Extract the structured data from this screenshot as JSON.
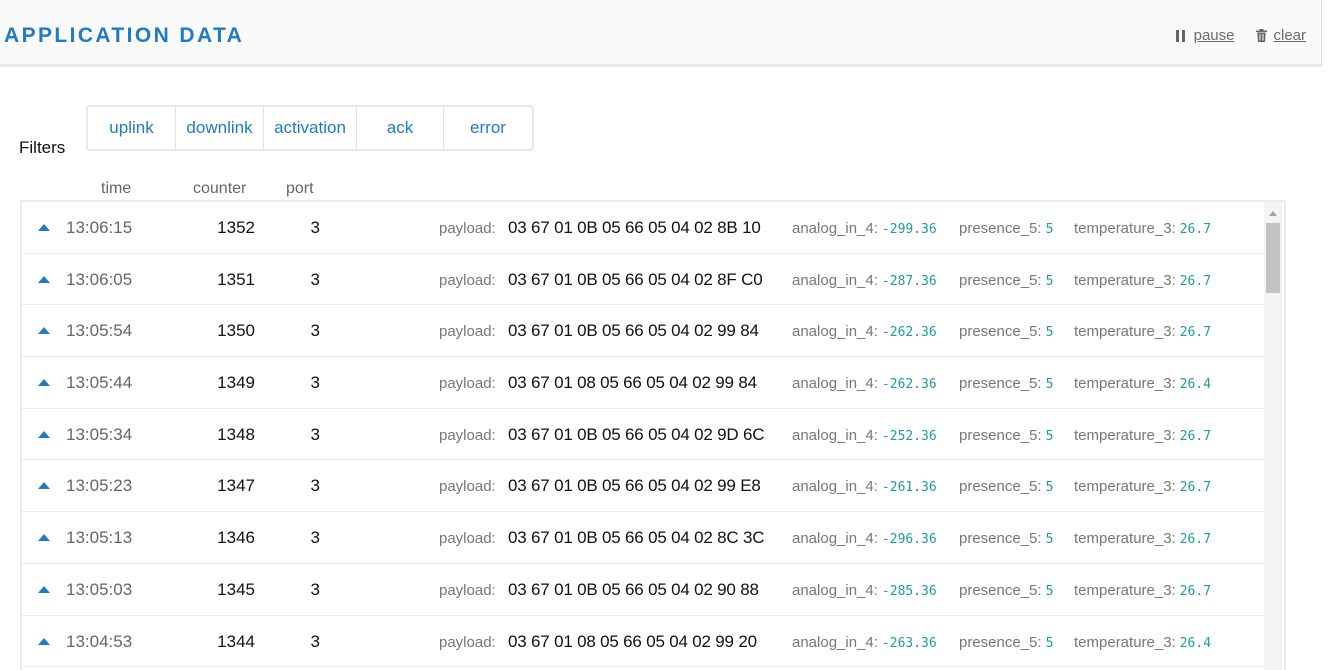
{
  "header": {
    "title": "APPLICATION DATA",
    "pause_label": "pause",
    "clear_label": "clear",
    "pause_icon": "pause-icon",
    "clear_icon": "trash-icon"
  },
  "filters": {
    "label": "Filters",
    "buttons": [
      "uplink",
      "downlink",
      "activation",
      "ack",
      "error"
    ]
  },
  "columns": {
    "time": "time",
    "counter": "counter",
    "port": "port"
  },
  "colors": {
    "accent": "#1f7bc4",
    "value": "#1e9c9c"
  },
  "field_labels": {
    "payload": "payload:",
    "analog": "analog_in_4:",
    "presence": "presence_5:",
    "temperature": "temperature_3:"
  },
  "rows": [
    {
      "time": "13:06:15",
      "counter": "1352",
      "port": "3",
      "payload": "03 67 01 0B 05 66 05 04 02 8B 10",
      "analog_in_4": "-299.36",
      "presence_5": "5",
      "temperature_3": "26.7"
    },
    {
      "time": "13:06:05",
      "counter": "1351",
      "port": "3",
      "payload": "03 67 01 0B 05 66 05 04 02 8F C0",
      "analog_in_4": "-287.36",
      "presence_5": "5",
      "temperature_3": "26.7"
    },
    {
      "time": "13:05:54",
      "counter": "1350",
      "port": "3",
      "payload": "03 67 01 0B 05 66 05 04 02 99 84",
      "analog_in_4": "-262.36",
      "presence_5": "5",
      "temperature_3": "26.7"
    },
    {
      "time": "13:05:44",
      "counter": "1349",
      "port": "3",
      "payload": "03 67 01 08 05 66 05 04 02 99 84",
      "analog_in_4": "-262.36",
      "presence_5": "5",
      "temperature_3": "26.4"
    },
    {
      "time": "13:05:34",
      "counter": "1348",
      "port": "3",
      "payload": "03 67 01 0B 05 66 05 04 02 9D 6C",
      "analog_in_4": "-252.36",
      "presence_5": "5",
      "temperature_3": "26.7"
    },
    {
      "time": "13:05:23",
      "counter": "1347",
      "port": "3",
      "payload": "03 67 01 0B 05 66 05 04 02 99 E8",
      "analog_in_4": "-261.36",
      "presence_5": "5",
      "temperature_3": "26.7"
    },
    {
      "time": "13:05:13",
      "counter": "1346",
      "port": "3",
      "payload": "03 67 01 0B 05 66 05 04 02 8C 3C",
      "analog_in_4": "-296.36",
      "presence_5": "5",
      "temperature_3": "26.7"
    },
    {
      "time": "13:05:03",
      "counter": "1345",
      "port": "3",
      "payload": "03 67 01 0B 05 66 05 04 02 90 88",
      "analog_in_4": "-285.36",
      "presence_5": "5",
      "temperature_3": "26.7"
    },
    {
      "time": "13:04:53",
      "counter": "1344",
      "port": "3",
      "payload": "03 67 01 08 05 66 05 04 02 99 20",
      "analog_in_4": "-263.36",
      "presence_5": "5",
      "temperature_3": "26.4"
    }
  ]
}
